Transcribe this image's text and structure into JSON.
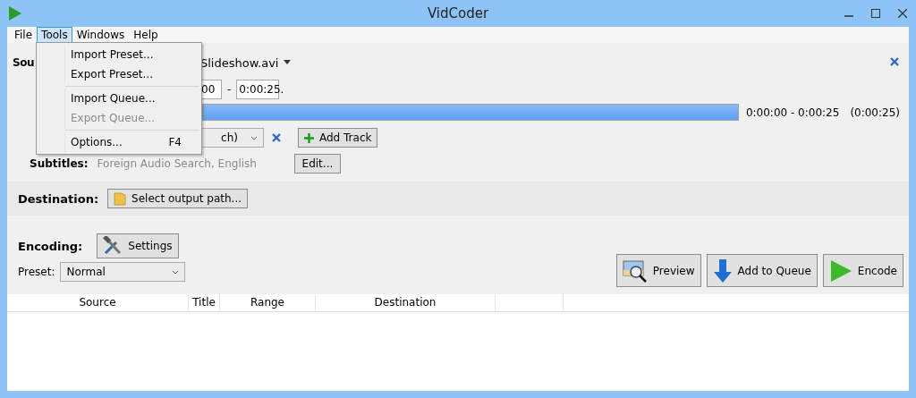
{
  "window": {
    "title": "VidCoder"
  },
  "menu": [
    {
      "label": "File",
      "selected": false
    },
    {
      "label": "Tools",
      "selected": true
    },
    {
      "label": "Windows",
      "selected": false
    },
    {
      "label": "Help",
      "selected": false
    }
  ],
  "dropdown": [
    {
      "kind": "item",
      "label": "Import Preset...",
      "disabled": false
    },
    {
      "kind": "item",
      "label": "Export Preset...",
      "disabled": false
    },
    {
      "kind": "separator"
    },
    {
      "kind": "item",
      "label": "Import Queue...",
      "disabled": false
    },
    {
      "kind": "item",
      "label": "Export Queue...",
      "disabled": true
    },
    {
      "kind": "separator"
    },
    {
      "kind": "item",
      "label": "Options...",
      "shortcut": "F4",
      "disabled": false
    }
  ],
  "source": {
    "label": "Sou",
    "file": "Slideshow.avi",
    "range_start": "00",
    "range_separator": "-",
    "range_end": "0:00:25.",
    "level": 1,
    "range_text": "0:00:00 - 0:00:25",
    "duration": "(0:00:25)",
    "audio": "ch)",
    "add_track": "Add Track",
    "subtitles_label": "Subtitles:",
    "subtitles": "Foreign Audio Search, English",
    "edit": "Edit..."
  },
  "destination": {
    "label": "Destination:",
    "button": "Select output path..."
  },
  "encoding": {
    "label": "Encoding:",
    "settings": "Settings",
    "preset_label": "Preset:",
    "preset": "Normal"
  },
  "actions": [
    {
      "kind": "preview",
      "label": "Preview"
    },
    {
      "kind": "queue",
      "label": "Add to Queue"
    },
    {
      "kind": "encode",
      "label": "Encode"
    }
  ],
  "table": {
    "columns": [
      "Source",
      "Title",
      "Range",
      "Destination"
    ]
  }
}
